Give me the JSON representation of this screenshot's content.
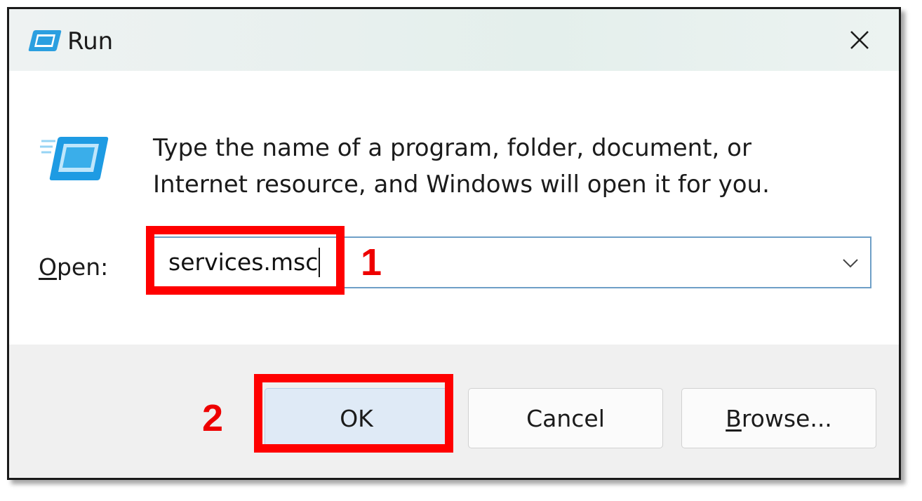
{
  "window": {
    "title": "Run"
  },
  "message": "Type the name of a program, folder, document, or Internet resource, and Windows will open it for you.",
  "open_field": {
    "label_accel": "O",
    "label_rest": "pen:",
    "value": "services.msc"
  },
  "buttons": {
    "ok": "OK",
    "cancel": "Cancel",
    "browse_accel": "B",
    "browse_rest": "rowse..."
  },
  "annotations": {
    "step1": "1",
    "step2": "2",
    "color": "#ff0000"
  },
  "icons": {
    "app": "run-icon",
    "close": "close-icon",
    "dropdown": "chevron-down-icon"
  },
  "colors": {
    "accent": "#2b9fe0",
    "input_border": "#6e9fc7",
    "ok_button_bg": "#dfeaf6"
  }
}
